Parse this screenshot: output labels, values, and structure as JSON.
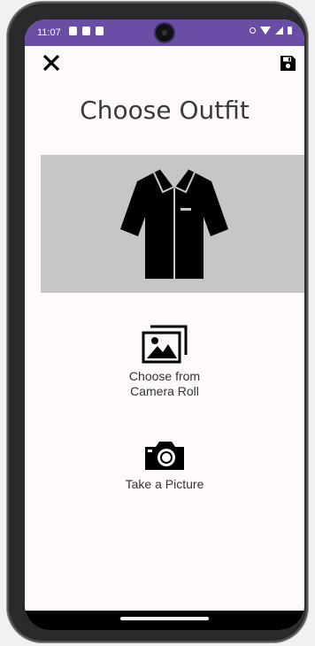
{
  "status_bar": {
    "time": "11:07",
    "color": "#6a4ea6"
  },
  "toolbar": {
    "close_icon": "close-icon",
    "save_icon": "floppy-disk-icon"
  },
  "page": {
    "title": "Choose Outfit"
  },
  "preview": {
    "icon": "shirt-icon",
    "background": "#c6c6c6"
  },
  "options": {
    "camera_roll": {
      "label_line1": "Choose from",
      "label_line2": "Camera Roll",
      "icon": "gallery-icon"
    },
    "take_picture": {
      "label": "Take a Picture",
      "icon": "camera-icon"
    }
  }
}
